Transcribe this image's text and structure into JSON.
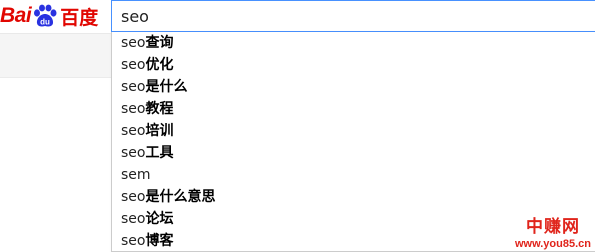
{
  "logo": {
    "latin": "Bai",
    "paw_text": "du",
    "chinese": "百度",
    "brand_red": "#e10601",
    "paw_blue": "#2932e1"
  },
  "search": {
    "query": "seo"
  },
  "suggestions": [
    {
      "prefix": "seo",
      "rest": "查询"
    },
    {
      "prefix": "seo",
      "rest": "优化"
    },
    {
      "prefix": "seo",
      "rest": "是什么"
    },
    {
      "prefix": "seo",
      "rest": "教程"
    },
    {
      "prefix": "seo",
      "rest": "培训"
    },
    {
      "prefix": "seo",
      "rest": "工具"
    },
    {
      "prefix": "sem",
      "rest": ""
    },
    {
      "prefix": "seo",
      "rest": "是什么意思"
    },
    {
      "prefix": "seo",
      "rest": "论坛"
    },
    {
      "prefix": "seo",
      "rest": "博客"
    }
  ],
  "watermark": {
    "cn": "中赚网",
    "url": "www.you85.cn",
    "color": "#e0241b"
  }
}
